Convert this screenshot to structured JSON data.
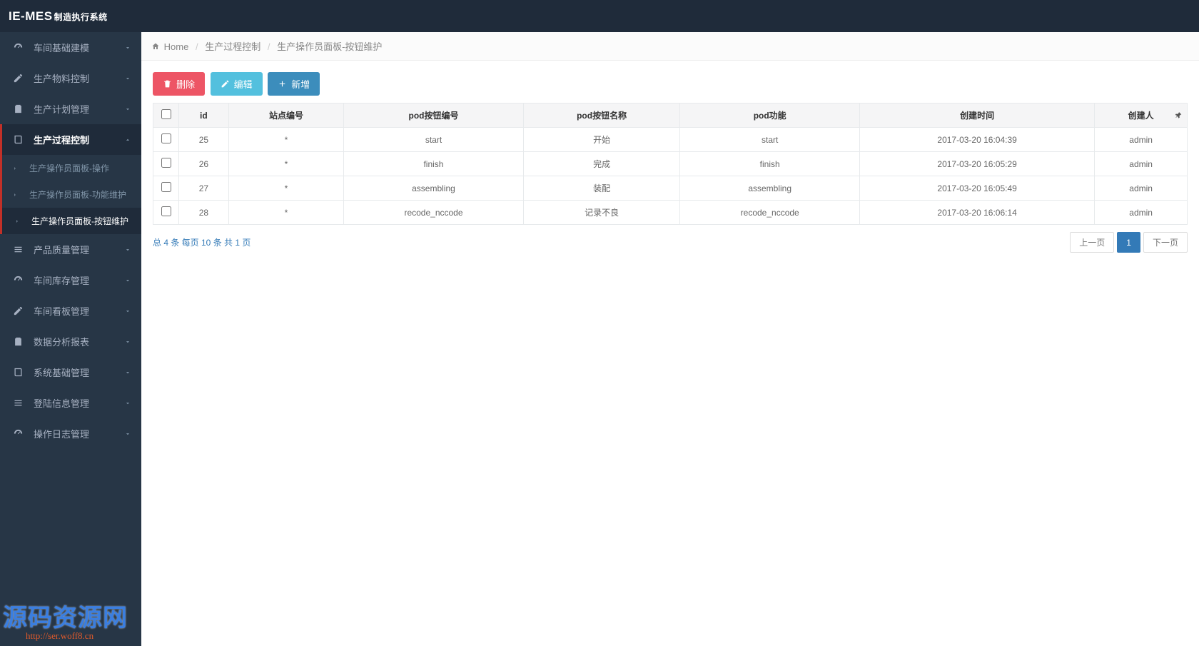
{
  "header": {
    "brand_main": "IE-MES",
    "brand_sub": "制造执行系统"
  },
  "sidebar": {
    "menu": [
      {
        "label": "车间基础建模",
        "icon": "dashboard",
        "expanded": false,
        "active": false
      },
      {
        "label": "生产物料控制",
        "icon": "edit",
        "expanded": false,
        "active": false
      },
      {
        "label": "生产计划管理",
        "icon": "clipboard",
        "expanded": false,
        "active": false
      },
      {
        "label": "生产过程控制",
        "icon": "book",
        "expanded": true,
        "active": true,
        "children": [
          {
            "label": "生产操作员面板-操作",
            "active": false
          },
          {
            "label": "生产操作员面板-功能维护",
            "active": false
          },
          {
            "label": "生产操作员面板-按钮维护",
            "active": true
          }
        ]
      },
      {
        "label": "产品质量管理",
        "icon": "list",
        "expanded": false,
        "active": false
      },
      {
        "label": "车间库存管理",
        "icon": "dashboard",
        "expanded": false,
        "active": false
      },
      {
        "label": "车间看板管理",
        "icon": "edit",
        "expanded": false,
        "active": false
      },
      {
        "label": "数据分析报表",
        "icon": "clipboard",
        "expanded": false,
        "active": false
      },
      {
        "label": "系统基础管理",
        "icon": "book",
        "expanded": false,
        "active": false
      },
      {
        "label": "登陆信息管理",
        "icon": "list",
        "expanded": false,
        "active": false
      },
      {
        "label": "操作日志管理",
        "icon": "dashboard",
        "expanded": false,
        "active": false
      }
    ]
  },
  "breadcrumb": {
    "home": "Home",
    "items": [
      "生产过程控制",
      "生产操作员面板-按钮维护"
    ]
  },
  "toolbar": {
    "delete": "删除",
    "edit": "编辑",
    "add": "新增"
  },
  "table": {
    "headers": [
      "id",
      "站点编号",
      "pod按钮编号",
      "pod按钮名称",
      "pod功能",
      "创建时间",
      "创建人"
    ],
    "rows": [
      {
        "id": "25",
        "site": "*",
        "btnNo": "start",
        "btnName": "开始",
        "func": "start",
        "created": "2017-03-20 16:04:39",
        "creator": "admin"
      },
      {
        "id": "26",
        "site": "*",
        "btnNo": "finish",
        "btnName": "完成",
        "func": "finish",
        "created": "2017-03-20 16:05:29",
        "creator": "admin"
      },
      {
        "id": "27",
        "site": "*",
        "btnNo": "assembling",
        "btnName": "装配",
        "func": "assembling",
        "created": "2017-03-20 16:05:49",
        "creator": "admin"
      },
      {
        "id": "28",
        "site": "*",
        "btnNo": "recode_nccode",
        "btnName": "记录不良",
        "func": "recode_nccode",
        "created": "2017-03-20 16:06:14",
        "creator": "admin"
      }
    ]
  },
  "pagination": {
    "summary": "总 4 条  每页 10 条  共 1 页",
    "prev": "上一页",
    "next": "下一页",
    "pages": [
      "1"
    ],
    "current": "1"
  },
  "watermark": {
    "title": "源码资源网",
    "url": "http://ser.woff8.cn"
  }
}
